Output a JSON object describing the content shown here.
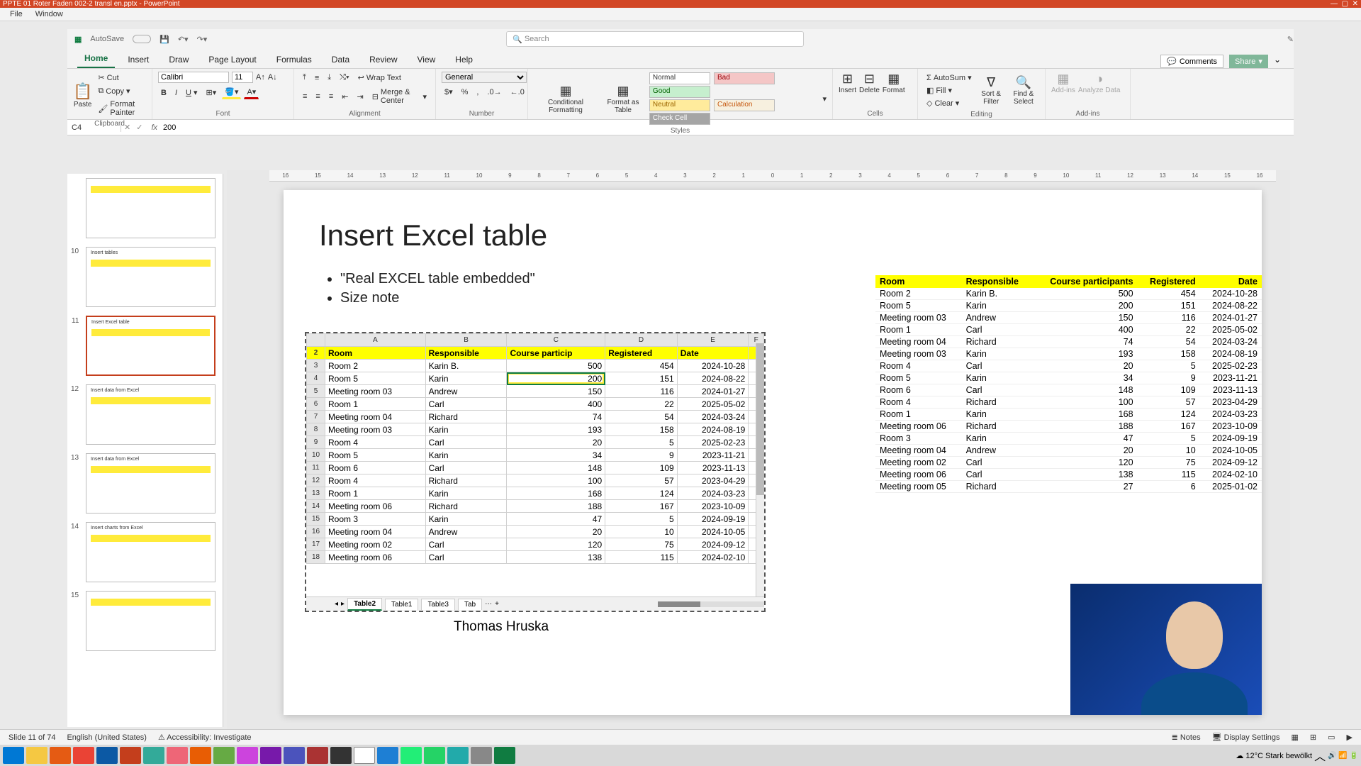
{
  "pp": {
    "title": "PPTE 01 Roter Faden 002-2 transl en.pptx - PowerPoint",
    "menu": [
      "File",
      "Window"
    ]
  },
  "xl": {
    "autosave": "AutoSave",
    "search_ph": "Search",
    "tabs": [
      "Home",
      "Insert",
      "Draw",
      "Page Layout",
      "Formulas",
      "Data",
      "Review",
      "View",
      "Help"
    ],
    "comments": "Comments",
    "share": "Share",
    "ribbon": {
      "clipboard": "Clipboard",
      "paste": "Paste",
      "cut": "Cut",
      "copy": "Copy",
      "fmtpainter": "Format Painter",
      "font": "Font",
      "fontname": "Calibri",
      "fontsize": "11",
      "alignment": "Alignment",
      "wrap": "Wrap Text",
      "merge": "Merge & Center",
      "number": "Number",
      "numfmt": "General",
      "styles": "Styles",
      "condfmt": "Conditional Formatting",
      "fmttable": "Format as Table",
      "s_normal": "Normal",
      "s_bad": "Bad",
      "s_good": "Good",
      "s_neutral": "Neutral",
      "s_calc": "Calculation",
      "s_check": "Check Cell",
      "cells": "Cells",
      "insert": "Insert",
      "delete": "Delete",
      "format": "Format",
      "editing": "Editing",
      "autosum": "AutoSum",
      "fill": "Fill",
      "clear": "Clear",
      "sort": "Sort & Filter",
      "find": "Find & Select",
      "addins": "Add-ins",
      "analyze": "Analyze Data"
    },
    "namebox": "C4",
    "formula": "200",
    "cols": [
      "A",
      "B",
      "C",
      "D",
      "E",
      "F"
    ],
    "header": [
      "Room",
      "Responsible",
      "Course particip",
      "Registered",
      "Date"
    ],
    "rows": [
      {
        "n": 3,
        "r": "Room 2",
        "p": "Karin B.",
        "c": "500",
        "g": "454",
        "d": "2024-10-28"
      },
      {
        "n": 4,
        "r": "Room 5",
        "p": "Karin",
        "c": "200",
        "g": "151",
        "d": "2024-08-22"
      },
      {
        "n": 5,
        "r": "Meeting room 03",
        "p": "Andrew",
        "c": "150",
        "g": "116",
        "d": "2024-01-27"
      },
      {
        "n": 6,
        "r": "Room 1",
        "p": "Carl",
        "c": "400",
        "g": "22",
        "d": "2025-05-02"
      },
      {
        "n": 7,
        "r": "Meeting room 04",
        "p": "Richard",
        "c": "74",
        "g": "54",
        "d": "2024-03-24"
      },
      {
        "n": 8,
        "r": "Meeting room 03",
        "p": "Karin",
        "c": "193",
        "g": "158",
        "d": "2024-08-19"
      },
      {
        "n": 9,
        "r": "Room 4",
        "p": "Carl",
        "c": "20",
        "g": "5",
        "d": "2025-02-23"
      },
      {
        "n": 10,
        "r": "Room 5",
        "p": "Karin",
        "c": "34",
        "g": "9",
        "d": "2023-11-21"
      },
      {
        "n": 11,
        "r": "Room 6",
        "p": "Carl",
        "c": "148",
        "g": "109",
        "d": "2023-11-13"
      },
      {
        "n": 12,
        "r": "Room 4",
        "p": "Richard",
        "c": "100",
        "g": "57",
        "d": "2023-04-29"
      },
      {
        "n": 13,
        "r": "Room 1",
        "p": "Karin",
        "c": "168",
        "g": "124",
        "d": "2024-03-23"
      },
      {
        "n": 14,
        "r": "Meeting room 06",
        "p": "Richard",
        "c": "188",
        "g": "167",
        "d": "2023-10-09"
      },
      {
        "n": 15,
        "r": "Room 3",
        "p": "Karin",
        "c": "47",
        "g": "5",
        "d": "2024-09-19"
      },
      {
        "n": 16,
        "r": "Meeting room 04",
        "p": "Andrew",
        "c": "20",
        "g": "10",
        "d": "2024-10-05"
      },
      {
        "n": 17,
        "r": "Meeting room 02",
        "p": "Carl",
        "c": "120",
        "g": "75",
        "d": "2024-09-12"
      },
      {
        "n": 18,
        "r": "Meeting room 06",
        "p": "Carl",
        "c": "138",
        "g": "115",
        "d": "2024-02-10"
      }
    ],
    "sheets": [
      "Table2",
      "Table1",
      "Table3",
      "Tab"
    ]
  },
  "slide": {
    "title": "Insert Excel table",
    "b1": "\"Real EXCEL table embedded\"",
    "b2": "Size note",
    "author": "Thomas Hruska"
  },
  "side": {
    "header": [
      "Room",
      "Responsible",
      "Course participants",
      "Registered",
      "Date"
    ],
    "rows": [
      [
        "Room 2",
        "Karin B.",
        "500",
        "454",
        "2024-10-28"
      ],
      [
        "Room 5",
        "Karin",
        "200",
        "151",
        "2024-08-22"
      ],
      [
        "Meeting room 03",
        "Andrew",
        "150",
        "116",
        "2024-01-27"
      ],
      [
        "Room 1",
        "Carl",
        "400",
        "22",
        "2025-05-02"
      ],
      [
        "Meeting room 04",
        "Richard",
        "74",
        "54",
        "2024-03-24"
      ],
      [
        "Meeting room 03",
        "Karin",
        "193",
        "158",
        "2024-08-19"
      ],
      [
        "Room 4",
        "Carl",
        "20",
        "5",
        "2025-02-23"
      ],
      [
        "Room 5",
        "Karin",
        "34",
        "9",
        "2023-11-21"
      ],
      [
        "Room 6",
        "Carl",
        "148",
        "109",
        "2023-11-13"
      ],
      [
        "Room 4",
        "Richard",
        "100",
        "57",
        "2023-04-29"
      ],
      [
        "Room 1",
        "Karin",
        "168",
        "124",
        "2024-03-23"
      ],
      [
        "Meeting room 06",
        "Richard",
        "188",
        "167",
        "2023-10-09"
      ],
      [
        "Room 3",
        "Karin",
        "47",
        "5",
        "2024-09-19"
      ],
      [
        "Meeting room 04",
        "Andrew",
        "20",
        "10",
        "2024-10-05"
      ],
      [
        "Meeting room 02",
        "Carl",
        "120",
        "75",
        "2024-09-12"
      ],
      [
        "Meeting room 06",
        "Carl",
        "138",
        "115",
        "2024-02-10"
      ],
      [
        "Meeting room 05",
        "Richard",
        "27",
        "6",
        "2025-01-02"
      ]
    ]
  },
  "thumbs": [
    {
      "n": "",
      "t": ""
    },
    {
      "n": "10",
      "t": "Insert tables"
    },
    {
      "n": "11",
      "t": "Insert Excel table",
      "sel": true
    },
    {
      "n": "12",
      "t": "Insert data from Excel"
    },
    {
      "n": "13",
      "t": "Insert data from Excel"
    },
    {
      "n": "14",
      "t": "Insert charts from Excel"
    },
    {
      "n": "15",
      "t": ""
    }
  ],
  "ruler": [
    "16",
    "15",
    "14",
    "13",
    "12",
    "11",
    "10",
    "9",
    "8",
    "7",
    "6",
    "5",
    "4",
    "3",
    "2",
    "1",
    "0",
    "1",
    "2",
    "3",
    "4",
    "5",
    "6",
    "7",
    "8",
    "9",
    "10",
    "11",
    "12",
    "13",
    "14",
    "15",
    "16"
  ],
  "status": {
    "slide": "Slide 11 of 74",
    "lang": "English (United States)",
    "acc": "Accessibility: Investigate",
    "notes": "Notes",
    "disp": "Display Settings"
  },
  "tray": {
    "weather": "12°C  Stark bewölkt"
  }
}
